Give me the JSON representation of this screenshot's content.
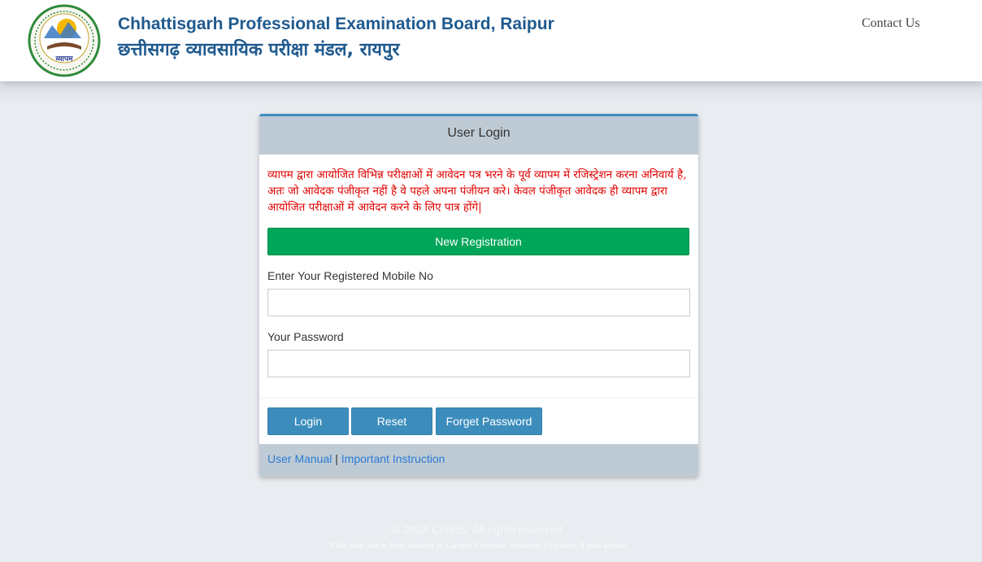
{
  "header": {
    "title_en": "Chhattisgarh Professional Examination Board, Raipur",
    "title_hi": "छत्तीसगढ़ व्यावसायिक परीक्षा मंडल, रायपुर",
    "contact_label": "Contact Us",
    "logo_text": "व्यापम"
  },
  "login": {
    "heading": "User Login",
    "notice": "व्यापम द्वारा आयोजित विभिन्न  परीक्षाओं में आवेदन पत्र भरने के पूर्व व्यापम में रजिस्ट्रेशन करना अनिवार्य है, अतः जो आवेदक पंजीकृत नहीं है वे पहले अपना  पंजीयन करे।  केवल पंजीकृत आवेदक ही व्यापम द्वारा आयोजित परीक्षाओं में आवेदन करने के लिए पात्र होंगे|",
    "new_registration_label": "New Registration",
    "mobile_label": "Enter Your Registered Mobile No",
    "mobile_value": "",
    "password_label": "Your Password",
    "password_value": "",
    "login_button": "Login",
    "reset_button": "Reset",
    "forget_button": "Forget Password",
    "user_manual_link": "User Manual",
    "separator": "|",
    "instruction_link": "Important Instruction"
  },
  "footer": {
    "copyright": "© 2024 CHiPS. All rights reserved.",
    "browser_note": "This web site is best viewed in Google Chrome, Internet Explorer 9 and above."
  },
  "colors": {
    "title": "#1f5a8f",
    "notice": "#e30000",
    "register_button": "#00a65a",
    "primary_button": "#3c8dbc",
    "panel_header": "#bfcbd4",
    "link": "#2a7bd6"
  }
}
